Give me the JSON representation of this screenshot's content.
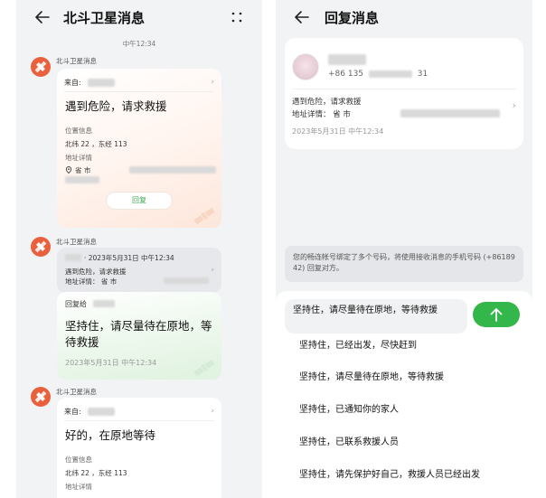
{
  "left": {
    "title": "北斗卫星消息",
    "time_divider": "中午12:34",
    "messages": [
      {
        "sender": "北斗卫星消息",
        "from_label": "来自:",
        "body": "遇到危险，请求救援",
        "location_label": "位置信息",
        "coords": "北纬 22      ，东经 113",
        "address_label": "地址详情",
        "address": "省      市",
        "reply_label": "回复"
      },
      {
        "sender": "北斗卫星消息",
        "quote_time": "· 2023年5月31日 中午12:34",
        "quote_body": "遇到危险，请求救援",
        "quote_address": "地址详情：      省      市",
        "reply_to_label": "回复给",
        "reply_body": "坚持住，请尽量待在原地，等待救援",
        "reply_time": "2023年5月31日 中午12:34"
      },
      {
        "sender": "北斗卫星消息",
        "from_label": "来自:",
        "body": "好的，在原地等待",
        "location_label": "位置信息",
        "coords": "北纬 22      ，东经 113",
        "address_label": "地址详情"
      }
    ]
  },
  "right": {
    "title": "回复消息",
    "contact": {
      "phone_prefix": "+86 135",
      "phone_suffix": "31",
      "message": "遇到危险，请求救援",
      "address": "地址详情：      省      市",
      "time": "2023年5月31日 中午12:34"
    },
    "notice": "您的畅连帐号绑定了多个号码，将使用接收消息的手机号码 (+86189          42) 回复对方。",
    "input_text": "坚持住，请尽量待在原地，等待救援",
    "quick_replies": [
      "坚持住，已经出发，尽快赶到",
      "坚持住，请尽量待在原地，等待救援",
      "坚持住，已通知你的家人",
      "坚持住，已联系救援人员",
      "坚持住，请先保护好自己，救援人员已经出发"
    ]
  },
  "colors": {
    "accent_green": "#33b64a",
    "reply_text_green": "#3aa84c",
    "satellite_avatar": "#e9613c"
  }
}
